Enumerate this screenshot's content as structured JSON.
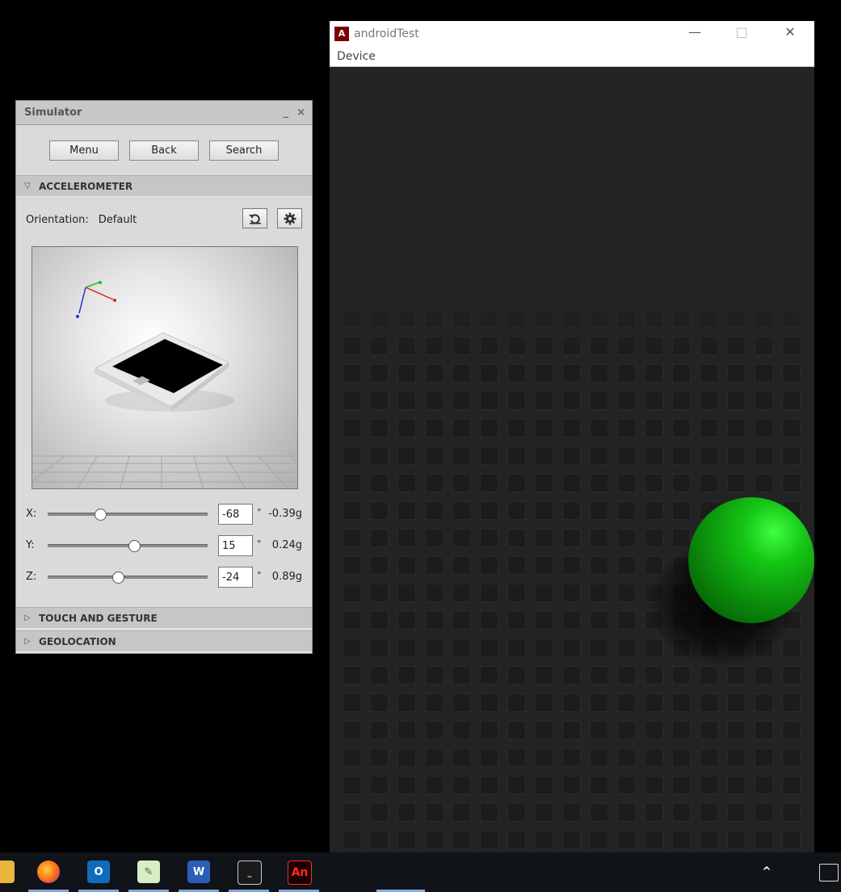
{
  "simulator": {
    "title": "Simulator",
    "minimize_glyph": "_",
    "close_glyph": "×",
    "buttons": {
      "menu": "Menu",
      "back": "Back",
      "search": "Search"
    },
    "accelerometer": {
      "header": "ACCELEROMETER",
      "orientation_label": "Orientation:",
      "orientation_value": "Default",
      "x": {
        "label": "X:",
        "value": "-68",
        "deg": "°",
        "g": "-0.39g",
        "position": 0.33
      },
      "y": {
        "label": "Y:",
        "value": "15",
        "deg": "°",
        "g": "0.24g",
        "position": 0.54
      },
      "z": {
        "label": "Z:",
        "value": "-24",
        "deg": "°",
        "g": "0.89g",
        "position": 0.44
      }
    },
    "touch_header": "TOUCH AND GESTURE",
    "geo_header": "GEOLOCATION"
  },
  "android_window": {
    "title": "androidTest",
    "logo_text": "A",
    "menu_device": "Device",
    "ctrl_min": "—",
    "ctrl_max": "□",
    "ctrl_close": "✕"
  },
  "taskbar": {
    "icons": [
      "file-explorer-icon",
      "firefox-icon",
      "outlook-icon",
      "notepad-plus-icon",
      "word-icon",
      "terminal-icon",
      "animate-icon"
    ],
    "outlook_letter": "O",
    "word_letter": "W",
    "animate_text": "An"
  },
  "colors": {
    "ball": "#1ecf1e",
    "screen_bg": "#232323",
    "accent_dark_red": "#7a0000"
  }
}
